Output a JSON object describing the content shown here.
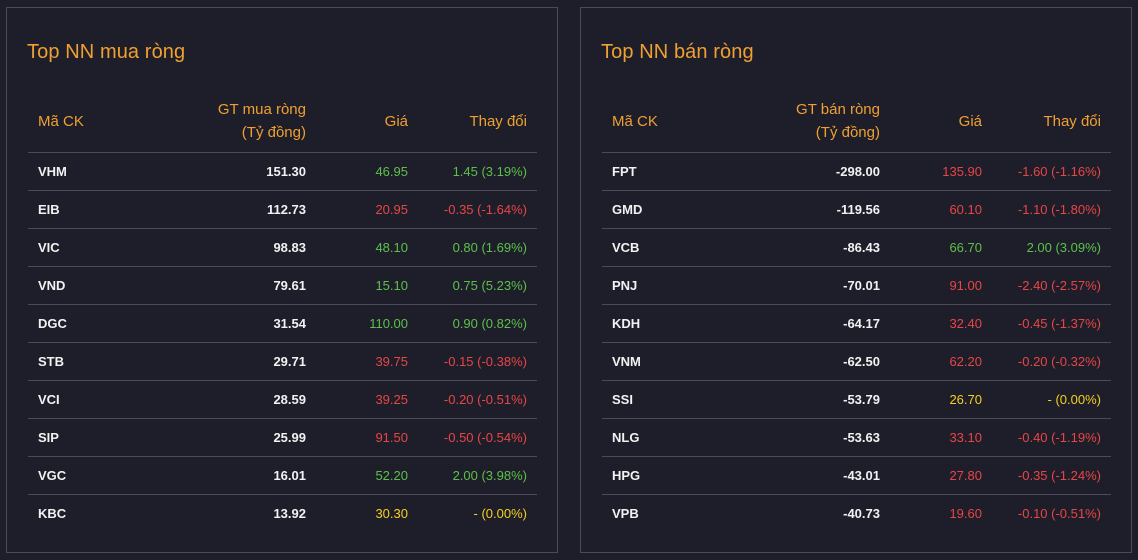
{
  "colors": {
    "accent": "#f0a030",
    "up": "#5cc04a",
    "down": "#e84545",
    "ref": "#f5d020",
    "background": "#1e1e2a"
  },
  "buy_panel": {
    "title": "Top NN mua ròng",
    "headers": {
      "symbol": "Mã CK",
      "value_line1": "GT mua ròng",
      "value_line2": "(Tỷ đồng)",
      "price": "Giá",
      "change": "Thay đổi"
    },
    "rows": [
      {
        "symbol": "VHM",
        "value": "151.30",
        "price": "46.95",
        "change": "1.45 (3.19%)",
        "trend": "up"
      },
      {
        "symbol": "EIB",
        "value": "112.73",
        "price": "20.95",
        "change": "-0.35 (-1.64%)",
        "trend": "down"
      },
      {
        "symbol": "VIC",
        "value": "98.83",
        "price": "48.10",
        "change": "0.80 (1.69%)",
        "trend": "up"
      },
      {
        "symbol": "VND",
        "value": "79.61",
        "price": "15.10",
        "change": "0.75 (5.23%)",
        "trend": "up"
      },
      {
        "symbol": "DGC",
        "value": "31.54",
        "price": "110.00",
        "change": "0.90 (0.82%)",
        "trend": "up"
      },
      {
        "symbol": "STB",
        "value": "29.71",
        "price": "39.75",
        "change": "-0.15 (-0.38%)",
        "trend": "down"
      },
      {
        "symbol": "VCI",
        "value": "28.59",
        "price": "39.25",
        "change": "-0.20 (-0.51%)",
        "trend": "down"
      },
      {
        "symbol": "SIP",
        "value": "25.99",
        "price": "91.50",
        "change": "-0.50 (-0.54%)",
        "trend": "down"
      },
      {
        "symbol": "VGC",
        "value": "16.01",
        "price": "52.20",
        "change": "2.00 (3.98%)",
        "trend": "up"
      },
      {
        "symbol": "KBC",
        "value": "13.92",
        "price": "30.30",
        "change": "- (0.00%)",
        "trend": "ref"
      }
    ]
  },
  "sell_panel": {
    "title": "Top NN bán ròng",
    "headers": {
      "symbol": "Mã CK",
      "value_line1": "GT bán ròng",
      "value_line2": "(Tỷ đồng)",
      "price": "Giá",
      "change": "Thay đổi"
    },
    "rows": [
      {
        "symbol": "FPT",
        "value": "-298.00",
        "price": "135.90",
        "change": "-1.60 (-1.16%)",
        "trend": "down"
      },
      {
        "symbol": "GMD",
        "value": "-119.56",
        "price": "60.10",
        "change": "-1.10 (-1.80%)",
        "trend": "down"
      },
      {
        "symbol": "VCB",
        "value": "-86.43",
        "price": "66.70",
        "change": "2.00 (3.09%)",
        "trend": "up"
      },
      {
        "symbol": "PNJ",
        "value": "-70.01",
        "price": "91.00",
        "change": "-2.40 (-2.57%)",
        "trend": "down"
      },
      {
        "symbol": "KDH",
        "value": "-64.17",
        "price": "32.40",
        "change": "-0.45 (-1.37%)",
        "trend": "down"
      },
      {
        "symbol": "VNM",
        "value": "-62.50",
        "price": "62.20",
        "change": "-0.20 (-0.32%)",
        "trend": "down"
      },
      {
        "symbol": "SSI",
        "value": "-53.79",
        "price": "26.70",
        "change": "- (0.00%)",
        "trend": "ref"
      },
      {
        "symbol": "NLG",
        "value": "-53.63",
        "price": "33.10",
        "change": "-0.40 (-1.19%)",
        "trend": "down"
      },
      {
        "symbol": "HPG",
        "value": "-43.01",
        "price": "27.80",
        "change": "-0.35 (-1.24%)",
        "trend": "down"
      },
      {
        "symbol": "VPB",
        "value": "-40.73",
        "price": "19.60",
        "change": "-0.10 (-0.51%)",
        "trend": "down"
      }
    ]
  }
}
